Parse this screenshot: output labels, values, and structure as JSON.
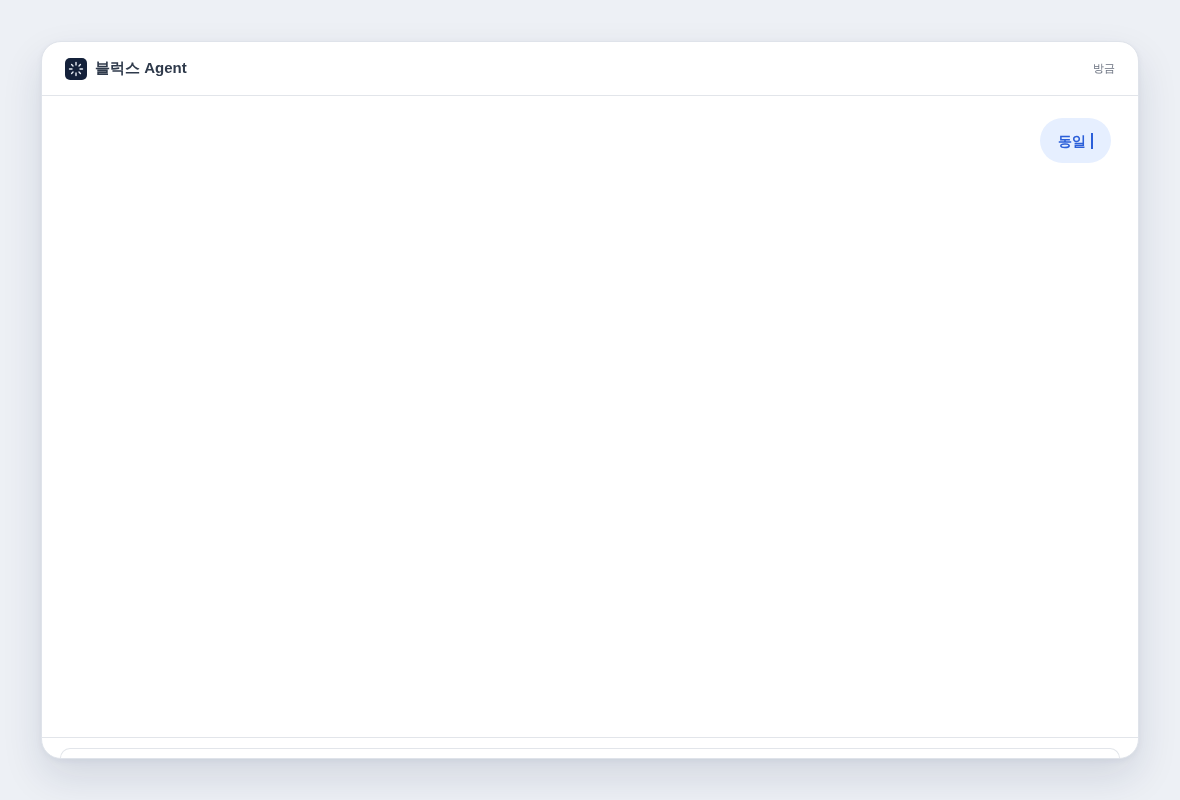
{
  "header": {
    "title": "블럭스 Agent",
    "time": "방금"
  },
  "messages": [
    {
      "kind": "user",
      "text": "동일",
      "streaming": true
    }
  ]
}
